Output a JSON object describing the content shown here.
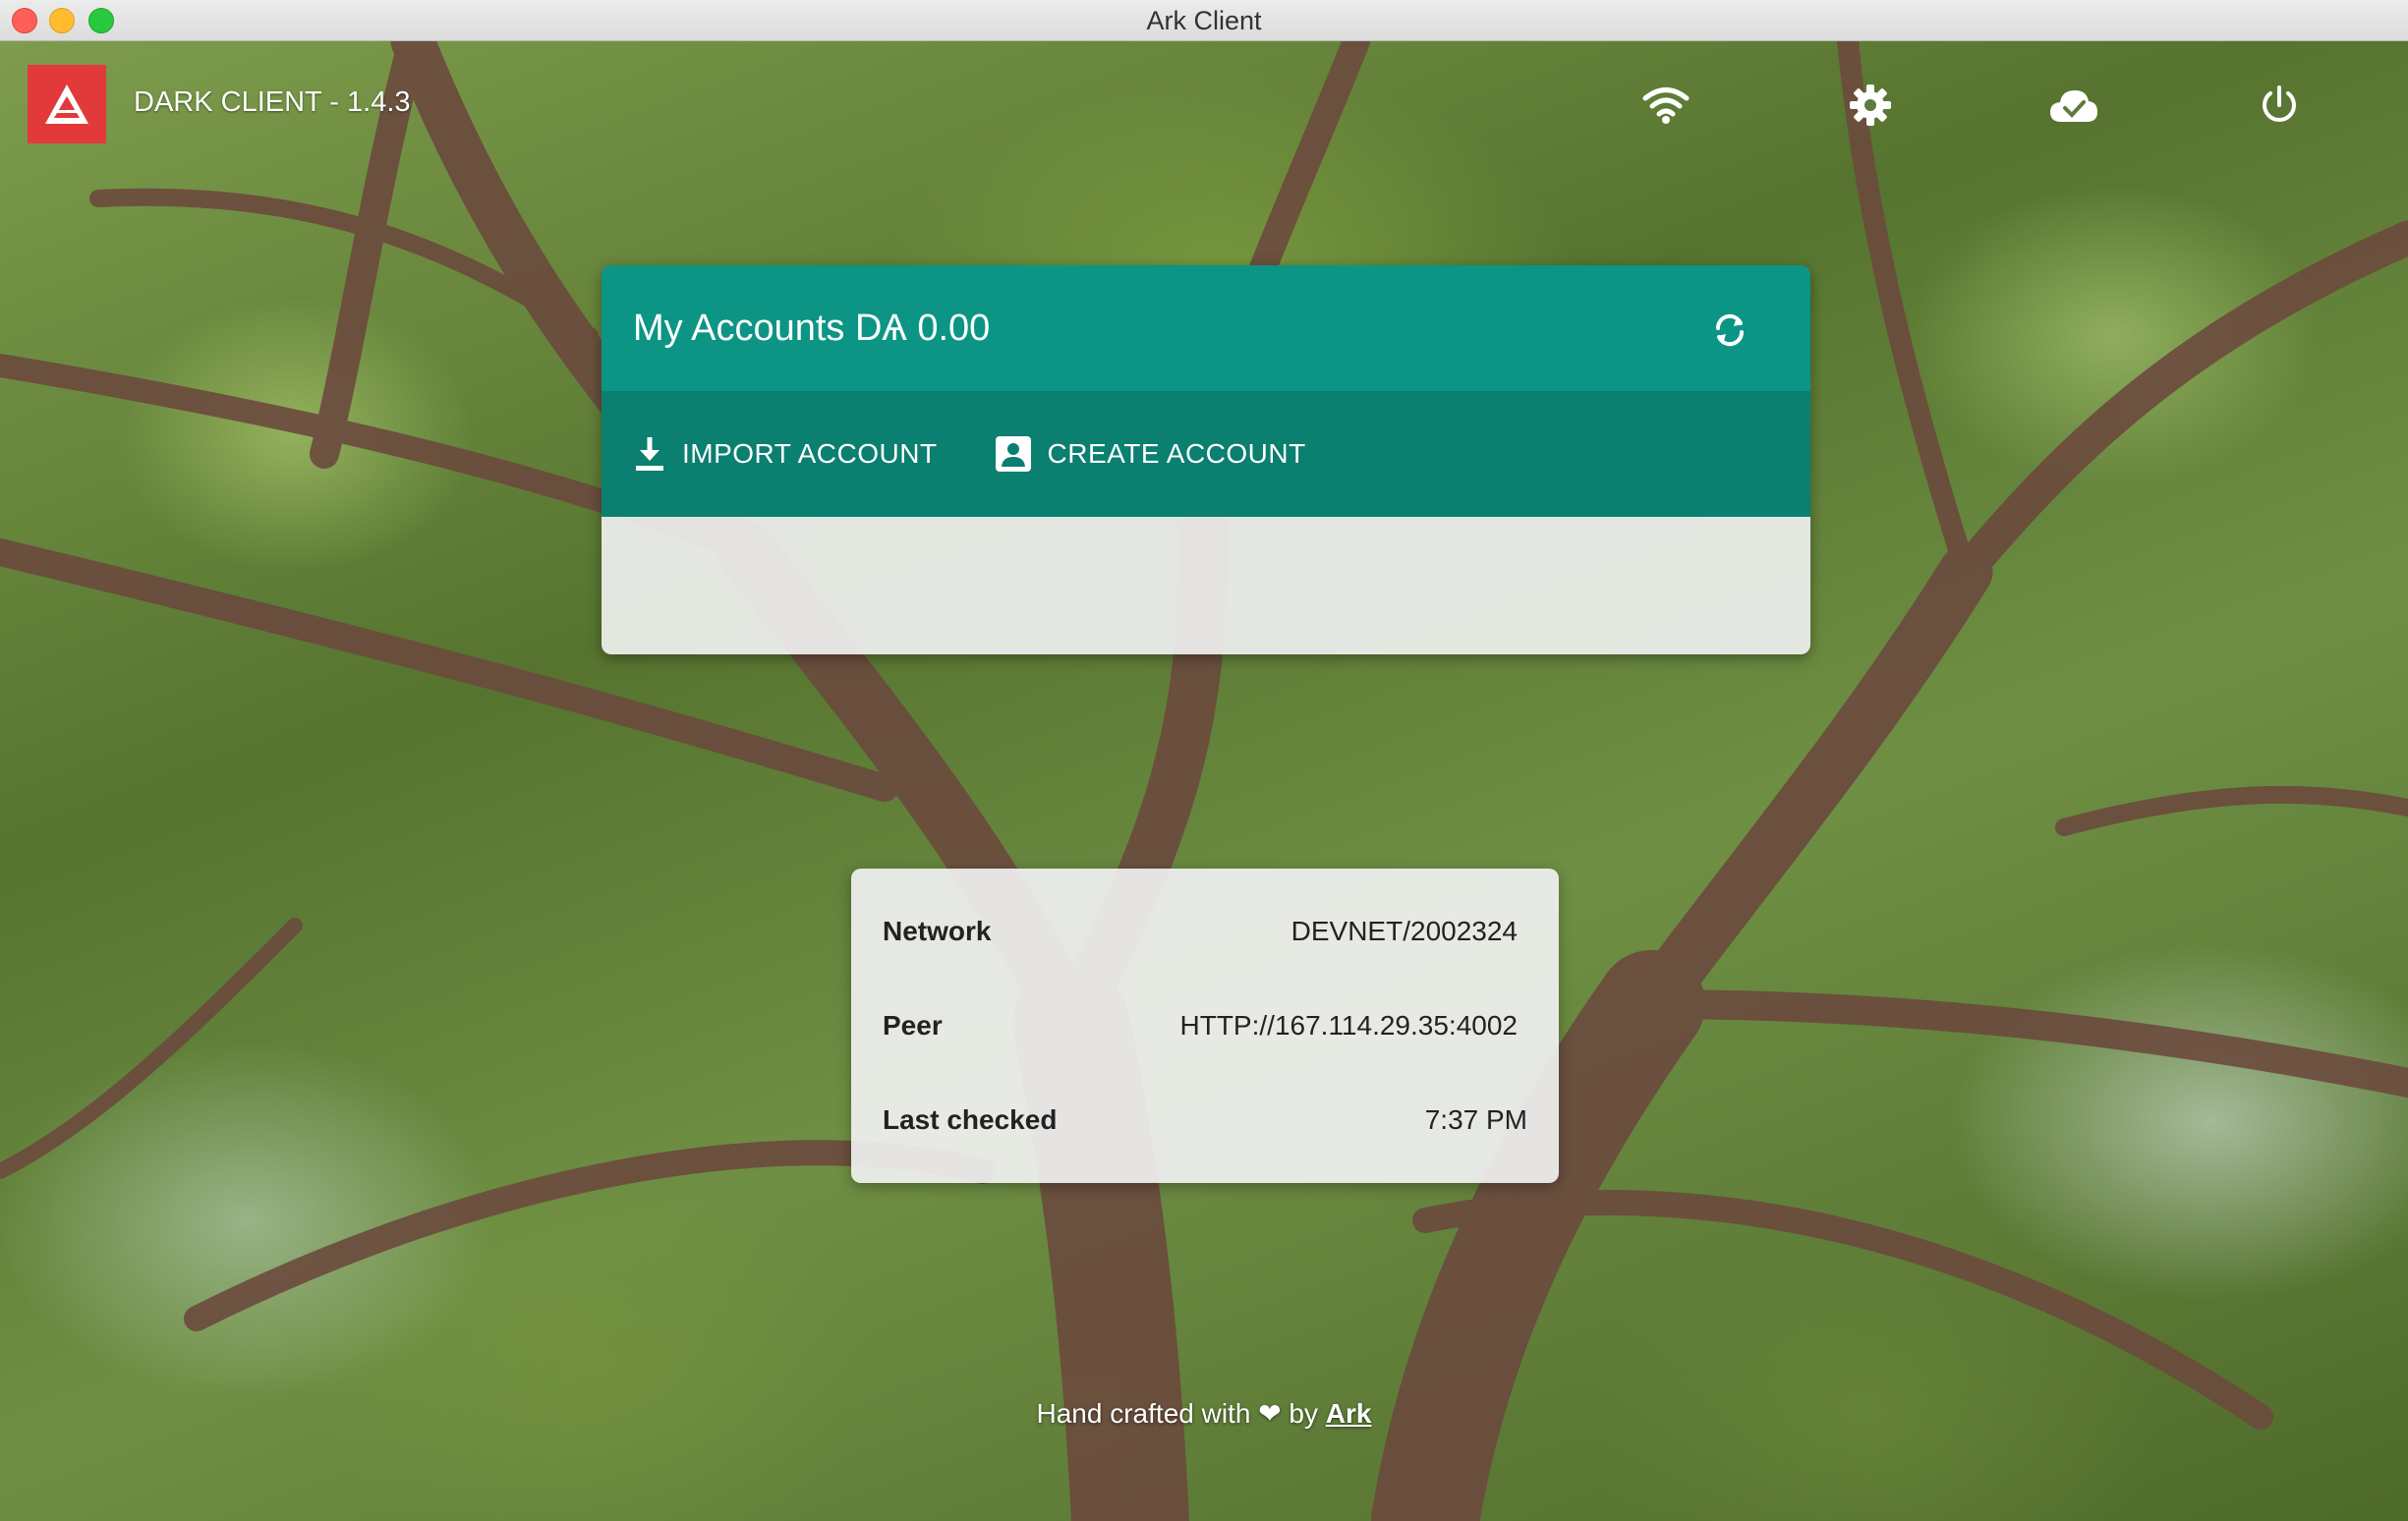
{
  "window": {
    "title": "Ark Client"
  },
  "header": {
    "brand": "DARK CLIENT - 1.4.3",
    "icons": [
      "wifi-icon",
      "gear-icon",
      "cloud-check-icon",
      "power-icon"
    ]
  },
  "accounts": {
    "title": "My Accounts DѦ 0.00",
    "import_label": "IMPORT ACCOUNT",
    "create_label": "CREATE ACCOUNT"
  },
  "network": {
    "rows": [
      {
        "label": "Network",
        "value": "DEVNET/2002324"
      },
      {
        "label": "Peer",
        "value": "HTTP://167.114.29.35:4002"
      },
      {
        "label": "Last checked",
        "value": "7:37 PM"
      }
    ]
  },
  "footer": {
    "text": "Hand crafted with ❤ by",
    "link": "Ark"
  },
  "colors": {
    "accent": "#0c9584",
    "accent_dark": "#0b7f70",
    "logo": "#e23a3a"
  }
}
